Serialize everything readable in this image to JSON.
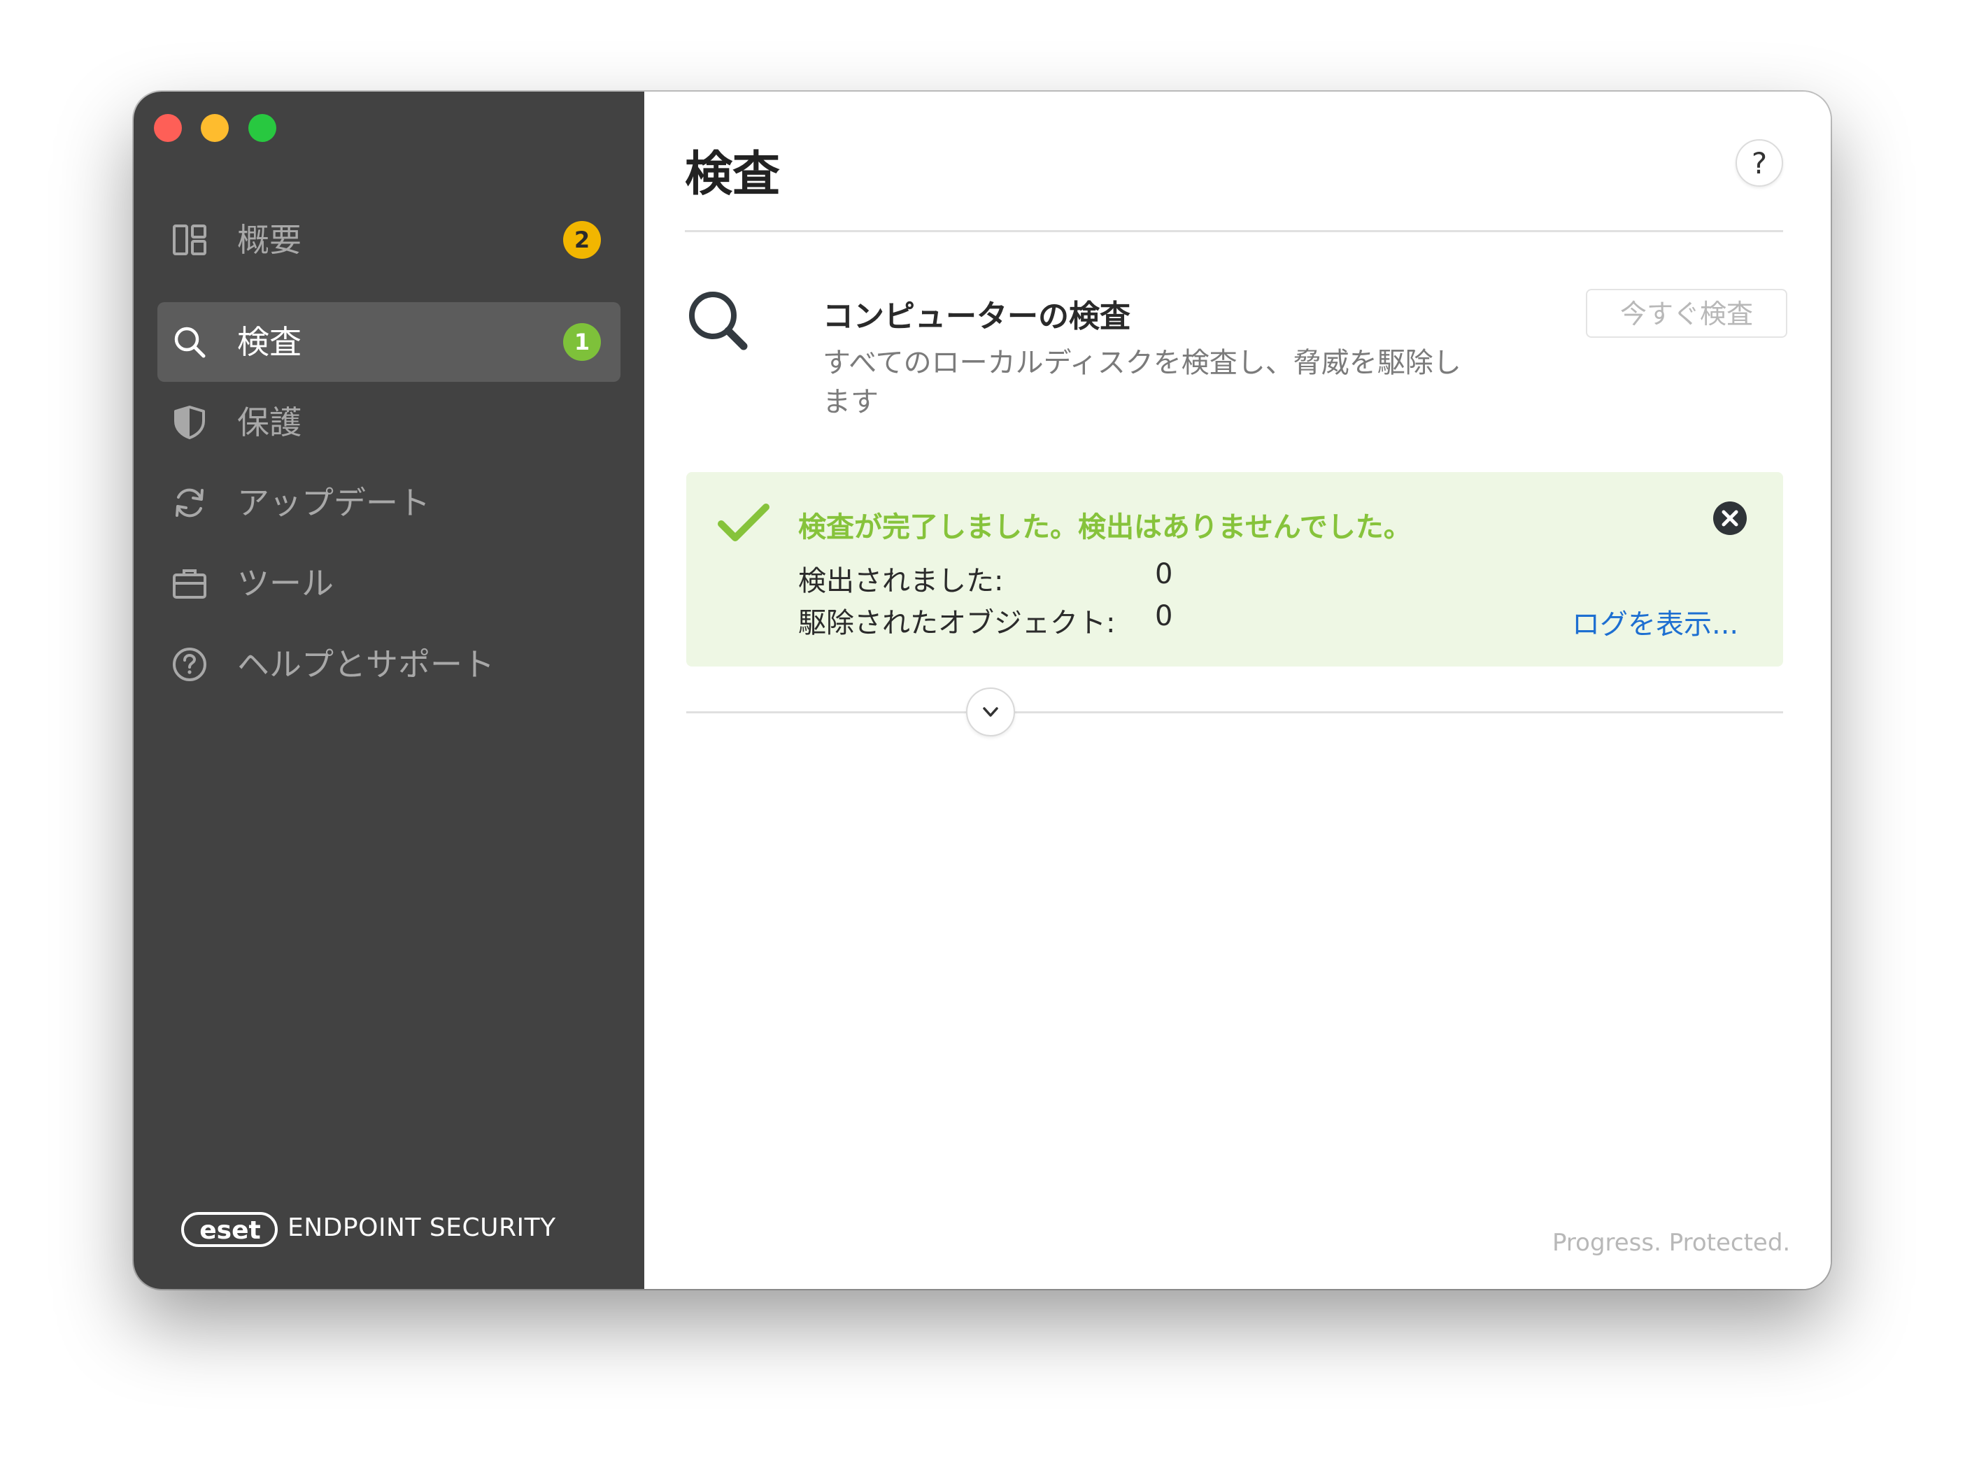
{
  "sidebar": {
    "items": [
      {
        "label": "概要",
        "icon": "dashboard-icon",
        "badge": "2",
        "badge_color": "#f2b600",
        "active": false
      },
      {
        "label": "検査",
        "icon": "search-icon",
        "badge": "1",
        "badge_color": "#7ec13a",
        "active": true
      },
      {
        "label": "保護",
        "icon": "shield-icon",
        "active": false
      },
      {
        "label": "アップデート",
        "icon": "refresh-icon",
        "active": false
      },
      {
        "label": "ツール",
        "icon": "toolbox-icon",
        "active": false
      },
      {
        "label": "ヘルプとサポート",
        "icon": "help-circle-icon",
        "active": false
      }
    ],
    "brand": {
      "logo_text": "eset",
      "product": "ENDPOINT SECURITY"
    }
  },
  "main": {
    "title": "検査",
    "help_label": "?",
    "scan": {
      "title": "コンピューターの検査",
      "description": "すべてのローカルディスクを検査し、脅威を駆除します",
      "button_label": "今すぐ検査"
    },
    "result": {
      "message": "検査が完了しました。検出はありませんでした。",
      "detected_label": "検出されました:",
      "detected_value": "0",
      "cleaned_label": "駆除されたオブジェクト:",
      "cleaned_value": "0",
      "log_link": "ログを表示..."
    },
    "tagline": "Progress. Protected."
  },
  "colors": {
    "sidebar_bg": "#424242",
    "accent_green": "#86c33b",
    "link_blue": "#1d6fd1",
    "badge_yellow": "#f2b600",
    "badge_green": "#7ec13a",
    "result_bg": "#eef7e4"
  }
}
